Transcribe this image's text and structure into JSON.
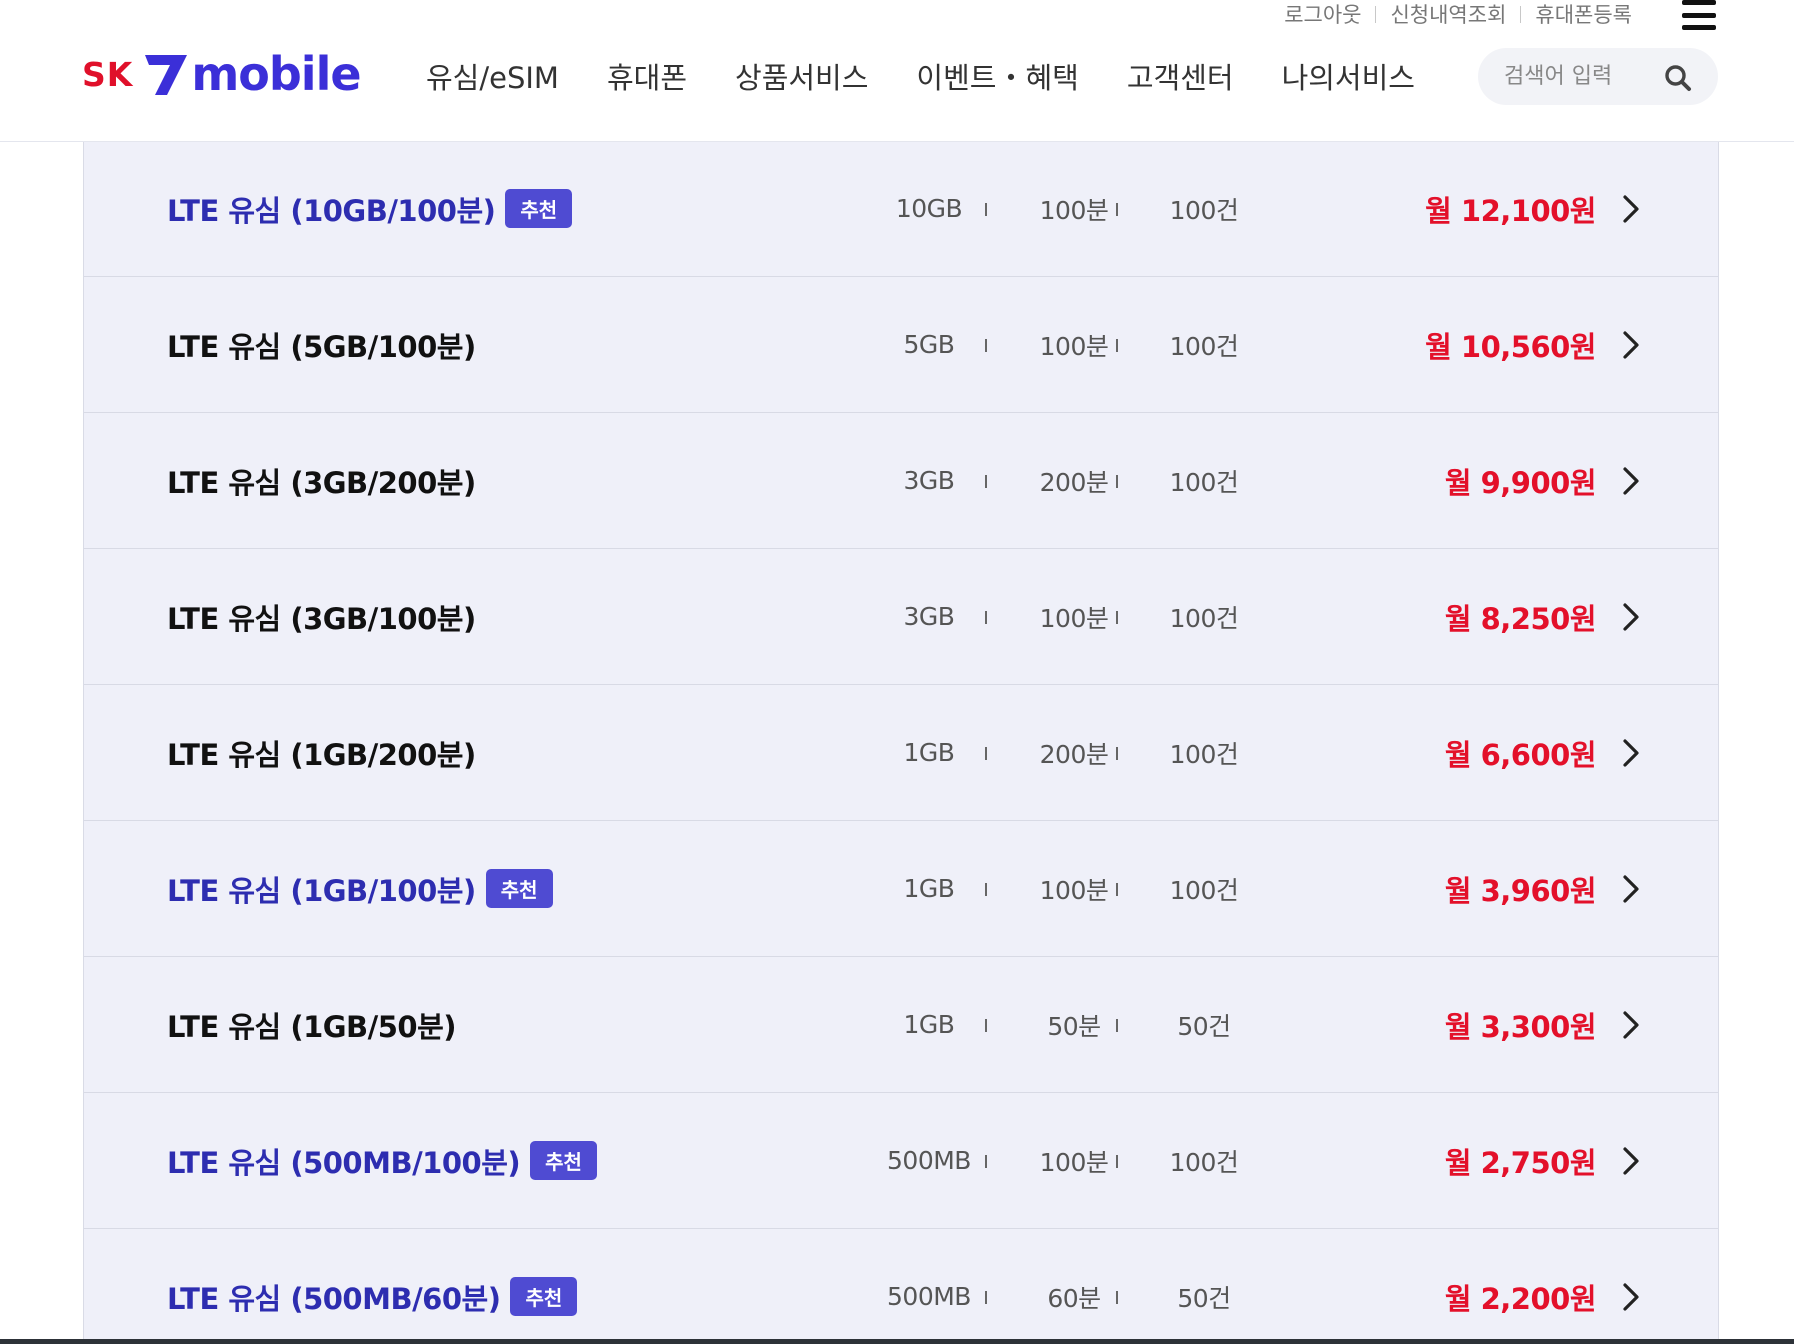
{
  "header": {
    "util_links": [
      "로그아웃",
      "신청내역조회",
      "휴대폰등록"
    ],
    "logo": {
      "sk": "SK",
      "word": "mobile"
    },
    "nav": [
      "유심/eSIM",
      "휴대폰",
      "상품서비스",
      "이벤트・혜택",
      "고객센터",
      "나의서비스"
    ],
    "search": {
      "placeholder": "검색어 입력",
      "value": ""
    }
  },
  "colors": {
    "accent": "#3b2fd8",
    "brand_red": "#e0102a",
    "price_red": "#e3102a",
    "recommend_text": "#2d2db0",
    "badge_bg": "#4f4bd2",
    "list_bg": "#eff0f9"
  },
  "plans": [
    {
      "name": "LTE 유심 (10GB/100분)",
      "badge": "추천",
      "data": "10GB",
      "voice": "100분",
      "sms": "100건",
      "price": "월 12,100원"
    },
    {
      "name": "LTE 유심 (5GB/100분)",
      "badge": "",
      "data": "5GB",
      "voice": "100분",
      "sms": "100건",
      "price": "월 10,560원"
    },
    {
      "name": "LTE 유심 (3GB/200분)",
      "badge": "",
      "data": "3GB",
      "voice": "200분",
      "sms": "100건",
      "price": "월 9,900원"
    },
    {
      "name": "LTE 유심 (3GB/100분)",
      "badge": "",
      "data": "3GB",
      "voice": "100분",
      "sms": "100건",
      "price": "월 8,250원"
    },
    {
      "name": "LTE 유심 (1GB/200분)",
      "badge": "",
      "data": "1GB",
      "voice": "200분",
      "sms": "100건",
      "price": "월 6,600원"
    },
    {
      "name": "LTE 유심 (1GB/100분)",
      "badge": "추천",
      "data": "1GB",
      "voice": "100분",
      "sms": "100건",
      "price": "월 3,960원"
    },
    {
      "name": "LTE 유심 (1GB/50분)",
      "badge": "",
      "data": "1GB",
      "voice": "50분",
      "sms": "50건",
      "price": "월 3,300원"
    },
    {
      "name": "LTE 유심 (500MB/100분)",
      "badge": "추천",
      "data": "500MB",
      "voice": "100분",
      "sms": "100건",
      "price": "월 2,750원"
    },
    {
      "name": "LTE 유심 (500MB/60분)",
      "badge": "추천",
      "data": "500MB",
      "voice": "60분",
      "sms": "50건",
      "price": "월 2,200원"
    }
  ]
}
